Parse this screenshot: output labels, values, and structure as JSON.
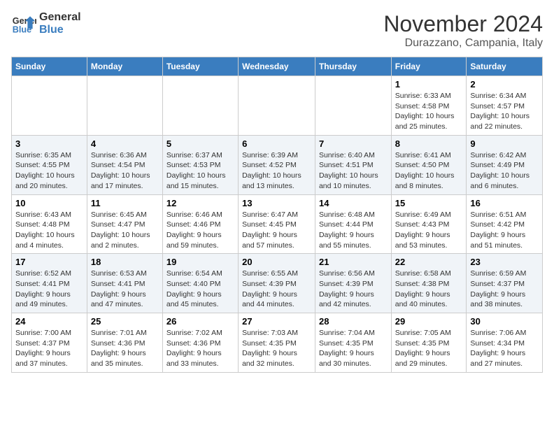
{
  "logo": {
    "line1": "General",
    "line2": "Blue"
  },
  "title": "November 2024",
  "location": "Durazzano, Campania, Italy",
  "weekdays": [
    "Sunday",
    "Monday",
    "Tuesday",
    "Wednesday",
    "Thursday",
    "Friday",
    "Saturday"
  ],
  "weeks": [
    [
      {
        "day": "",
        "info": ""
      },
      {
        "day": "",
        "info": ""
      },
      {
        "day": "",
        "info": ""
      },
      {
        "day": "",
        "info": ""
      },
      {
        "day": "",
        "info": ""
      },
      {
        "day": "1",
        "info": "Sunrise: 6:33 AM\nSunset: 4:58 PM\nDaylight: 10 hours and 25 minutes."
      },
      {
        "day": "2",
        "info": "Sunrise: 6:34 AM\nSunset: 4:57 PM\nDaylight: 10 hours and 22 minutes."
      }
    ],
    [
      {
        "day": "3",
        "info": "Sunrise: 6:35 AM\nSunset: 4:55 PM\nDaylight: 10 hours and 20 minutes."
      },
      {
        "day": "4",
        "info": "Sunrise: 6:36 AM\nSunset: 4:54 PM\nDaylight: 10 hours and 17 minutes."
      },
      {
        "day": "5",
        "info": "Sunrise: 6:37 AM\nSunset: 4:53 PM\nDaylight: 10 hours and 15 minutes."
      },
      {
        "day": "6",
        "info": "Sunrise: 6:39 AM\nSunset: 4:52 PM\nDaylight: 10 hours and 13 minutes."
      },
      {
        "day": "7",
        "info": "Sunrise: 6:40 AM\nSunset: 4:51 PM\nDaylight: 10 hours and 10 minutes."
      },
      {
        "day": "8",
        "info": "Sunrise: 6:41 AM\nSunset: 4:50 PM\nDaylight: 10 hours and 8 minutes."
      },
      {
        "day": "9",
        "info": "Sunrise: 6:42 AM\nSunset: 4:49 PM\nDaylight: 10 hours and 6 minutes."
      }
    ],
    [
      {
        "day": "10",
        "info": "Sunrise: 6:43 AM\nSunset: 4:48 PM\nDaylight: 10 hours and 4 minutes."
      },
      {
        "day": "11",
        "info": "Sunrise: 6:45 AM\nSunset: 4:47 PM\nDaylight: 10 hours and 2 minutes."
      },
      {
        "day": "12",
        "info": "Sunrise: 6:46 AM\nSunset: 4:46 PM\nDaylight: 9 hours and 59 minutes."
      },
      {
        "day": "13",
        "info": "Sunrise: 6:47 AM\nSunset: 4:45 PM\nDaylight: 9 hours and 57 minutes."
      },
      {
        "day": "14",
        "info": "Sunrise: 6:48 AM\nSunset: 4:44 PM\nDaylight: 9 hours and 55 minutes."
      },
      {
        "day": "15",
        "info": "Sunrise: 6:49 AM\nSunset: 4:43 PM\nDaylight: 9 hours and 53 minutes."
      },
      {
        "day": "16",
        "info": "Sunrise: 6:51 AM\nSunset: 4:42 PM\nDaylight: 9 hours and 51 minutes."
      }
    ],
    [
      {
        "day": "17",
        "info": "Sunrise: 6:52 AM\nSunset: 4:41 PM\nDaylight: 9 hours and 49 minutes."
      },
      {
        "day": "18",
        "info": "Sunrise: 6:53 AM\nSunset: 4:41 PM\nDaylight: 9 hours and 47 minutes."
      },
      {
        "day": "19",
        "info": "Sunrise: 6:54 AM\nSunset: 4:40 PM\nDaylight: 9 hours and 45 minutes."
      },
      {
        "day": "20",
        "info": "Sunrise: 6:55 AM\nSunset: 4:39 PM\nDaylight: 9 hours and 44 minutes."
      },
      {
        "day": "21",
        "info": "Sunrise: 6:56 AM\nSunset: 4:39 PM\nDaylight: 9 hours and 42 minutes."
      },
      {
        "day": "22",
        "info": "Sunrise: 6:58 AM\nSunset: 4:38 PM\nDaylight: 9 hours and 40 minutes."
      },
      {
        "day": "23",
        "info": "Sunrise: 6:59 AM\nSunset: 4:37 PM\nDaylight: 9 hours and 38 minutes."
      }
    ],
    [
      {
        "day": "24",
        "info": "Sunrise: 7:00 AM\nSunset: 4:37 PM\nDaylight: 9 hours and 37 minutes."
      },
      {
        "day": "25",
        "info": "Sunrise: 7:01 AM\nSunset: 4:36 PM\nDaylight: 9 hours and 35 minutes."
      },
      {
        "day": "26",
        "info": "Sunrise: 7:02 AM\nSunset: 4:36 PM\nDaylight: 9 hours and 33 minutes."
      },
      {
        "day": "27",
        "info": "Sunrise: 7:03 AM\nSunset: 4:35 PM\nDaylight: 9 hours and 32 minutes."
      },
      {
        "day": "28",
        "info": "Sunrise: 7:04 AM\nSunset: 4:35 PM\nDaylight: 9 hours and 30 minutes."
      },
      {
        "day": "29",
        "info": "Sunrise: 7:05 AM\nSunset: 4:35 PM\nDaylight: 9 hours and 29 minutes."
      },
      {
        "day": "30",
        "info": "Sunrise: 7:06 AM\nSunset: 4:34 PM\nDaylight: 9 hours and 27 minutes."
      }
    ]
  ]
}
